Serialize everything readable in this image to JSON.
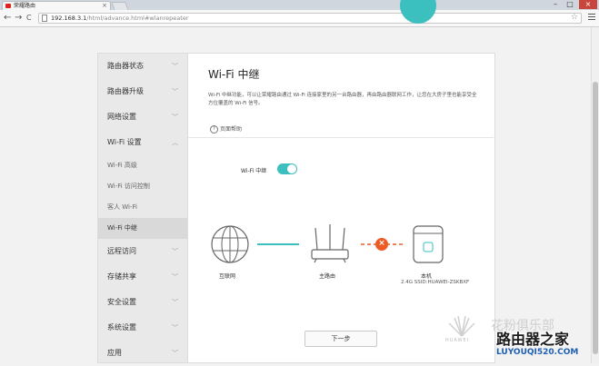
{
  "browser": {
    "tab_title": "荣耀路由",
    "url_host": "192.168.3.1",
    "url_path": "/html/advance.html#wlanrepeater",
    "new_tab_label": "",
    "back_icon": "←",
    "forward_icon": "→",
    "reload_icon": "C",
    "star_icon": "☆",
    "tab_close_icon": "×",
    "min_icon": "–",
    "max_icon": "□",
    "close_icon": "×"
  },
  "sidebar": {
    "items": [
      {
        "label": "路由器状态",
        "chevron": "﹀"
      },
      {
        "label": "路由器升级",
        "chevron": "﹀"
      },
      {
        "label": "网络设置",
        "chevron": "﹀"
      },
      {
        "label": "Wi-Fi 设置",
        "chevron": "︿"
      }
    ],
    "sub_items": [
      {
        "label": "Wi-Fi 高级"
      },
      {
        "label": "Wi-Fi 访问控制"
      },
      {
        "label": "客人 Wi-Fi"
      },
      {
        "label": "Wi-Fi 中继"
      }
    ],
    "items_after": [
      {
        "label": "远程访问",
        "chevron": "﹀"
      },
      {
        "label": "存储共享",
        "chevron": "﹀"
      },
      {
        "label": "安全设置",
        "chevron": "﹀"
      },
      {
        "label": "系统设置",
        "chevron": "﹀"
      },
      {
        "label": "应用",
        "chevron": "﹀"
      }
    ]
  },
  "main": {
    "title": "Wi-Fi 中继",
    "description": "Wi-Fi 中继功能，可以让荣耀路由通过 Wi-Fi 连接家里的另一台路由器，再由路由器联网工作，让您在大房子里也能享受全方位覆盖的 Wi-Fi 信号。",
    "help_icon": "?",
    "help_label": "页面帮助",
    "toggle_label": "Wi-Fi 中继",
    "toggle_on": true,
    "nodes": {
      "internet": "互联网",
      "router": "主路由",
      "local": "本机",
      "local_ssid": "2.4G SSID:HUAWEI-ZSKBXF"
    },
    "link_status_icon": "×",
    "next_label": "下一步"
  },
  "watermarks": {
    "huawei": "HUAWEI",
    "grey_text": "花粉俱乐部",
    "site_cn": "路由器之家",
    "site_domain": "LUYOUQI520.COM"
  },
  "colors": {
    "accent": "#3bbfbf",
    "error": "#ee5a24"
  }
}
